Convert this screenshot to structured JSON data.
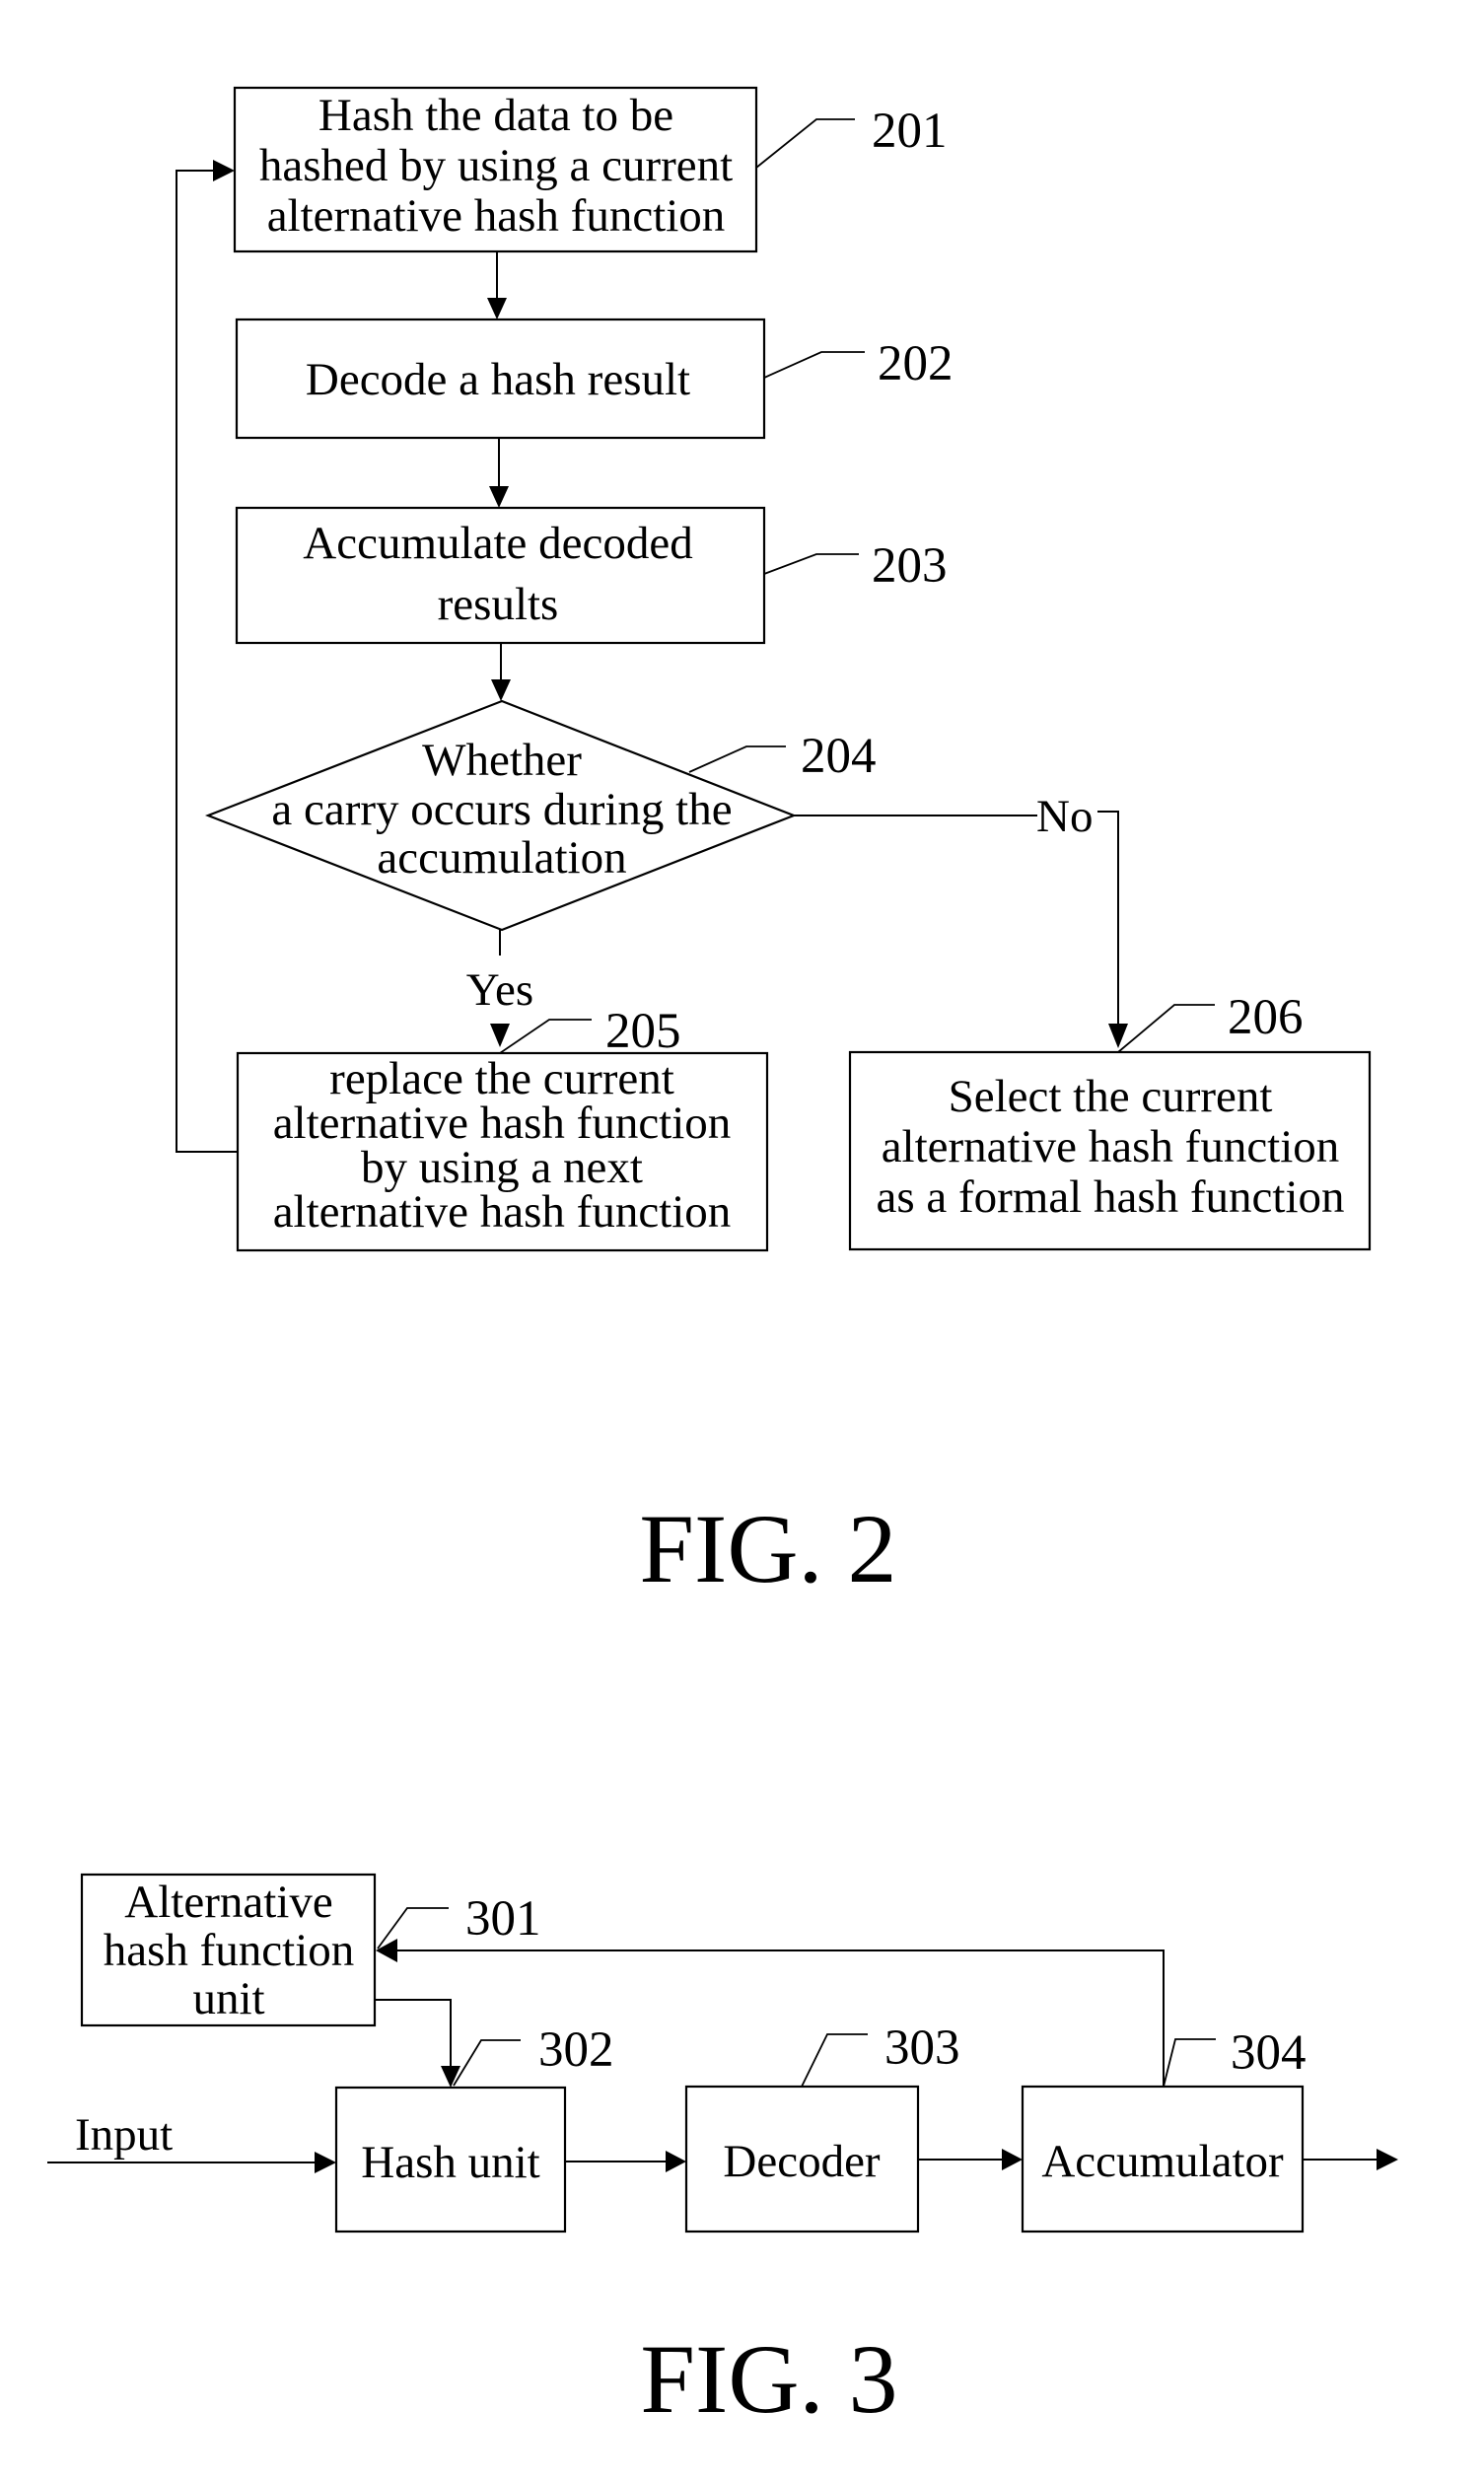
{
  "figures": [
    {
      "caption": "FIG. 2",
      "steps": [
        {
          "ref": "201",
          "lines": [
            "Hash the data to be",
            "hashed by using a current",
            "alternative hash function"
          ]
        },
        {
          "ref": "202",
          "lines": [
            "Decode a hash result"
          ]
        },
        {
          "ref": "203",
          "lines": [
            "Accumulate decoded",
            "results"
          ]
        },
        {
          "ref": "204",
          "lines": [
            "Whether",
            "a carry occurs during the",
            "accumulation"
          ],
          "shape": "decision"
        },
        {
          "ref": "205",
          "lines": [
            "replace the current",
            "alternative hash function",
            "by using a next",
            "alternative hash function"
          ]
        },
        {
          "ref": "206",
          "lines": [
            "Select the current",
            "alternative hash function",
            "as a formal hash function"
          ]
        }
      ],
      "branches": {
        "yes": "Yes",
        "no": "No"
      }
    },
    {
      "caption": "FIG. 3",
      "blocks": [
        {
          "ref": "301",
          "lines": [
            "Alternative",
            "hash function",
            "unit"
          ]
        },
        {
          "ref": "302",
          "lines": [
            "Hash unit"
          ]
        },
        {
          "ref": "303",
          "lines": [
            "Decoder"
          ]
        },
        {
          "ref": "304",
          "lines": [
            "Accumulator"
          ]
        }
      ],
      "input_label": "Input"
    }
  ]
}
